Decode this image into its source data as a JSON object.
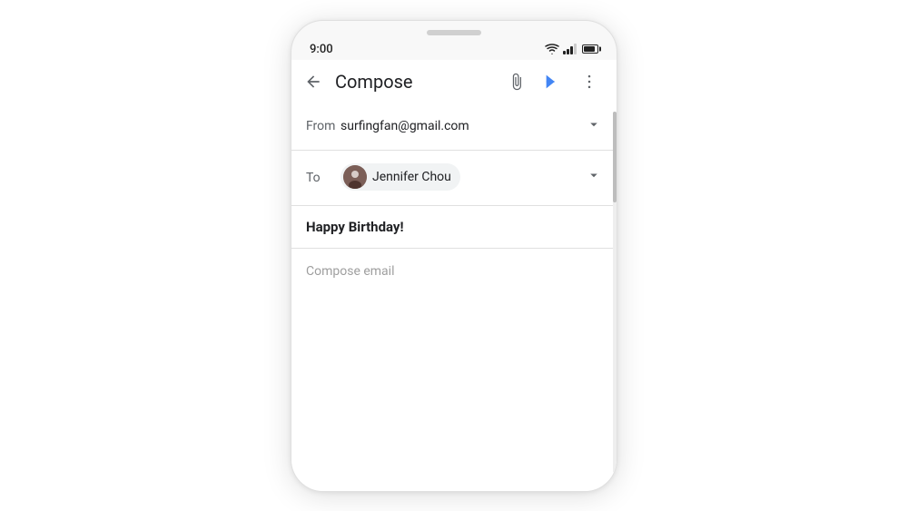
{
  "status_bar": {
    "time": "9:00",
    "wifi_label": "wifi",
    "signal_label": "signal",
    "battery_label": "battery"
  },
  "toolbar": {
    "back_label": "back",
    "title": "Compose",
    "attach_label": "attach",
    "send_label": "send",
    "more_label": "more options"
  },
  "compose": {
    "from_label": "From",
    "from_value": "surfingfan@gmail.com",
    "to_label": "To",
    "recipient_name": "Jennifer Chou",
    "subject_value": "Happy Birthday!",
    "body_placeholder": "Compose email"
  },
  "colors": {
    "send_icon": "#4285f4",
    "chip_bg": "#f1f3f4",
    "border": "#e0e0e0"
  }
}
